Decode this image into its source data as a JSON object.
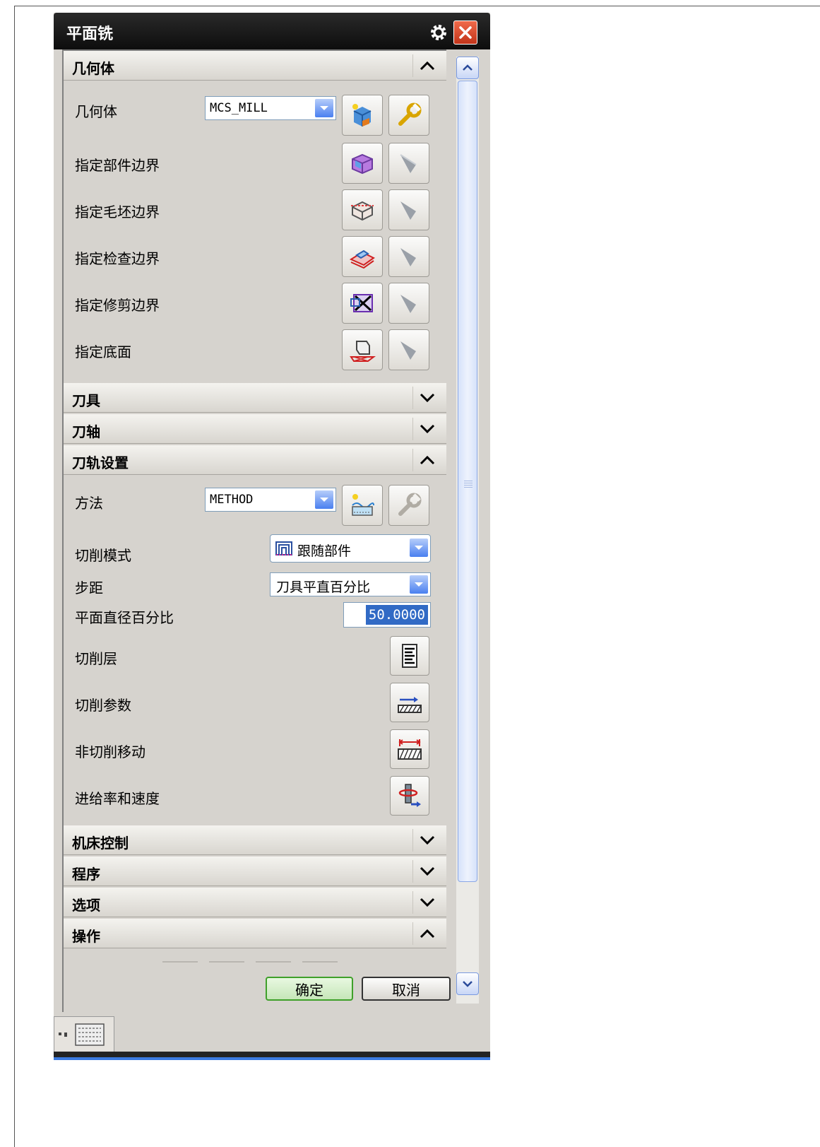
{
  "window": {
    "title": "平面铣"
  },
  "sections": {
    "geometry": {
      "title": "几何体",
      "expanded": true,
      "geometry_label": "几何体",
      "geometry_value": "MCS_MILL",
      "rows": [
        {
          "label": "指定部件边界"
        },
        {
          "label": "指定毛坯边界"
        },
        {
          "label": "指定检查边界"
        },
        {
          "label": "指定修剪边界"
        },
        {
          "label": "指定底面"
        }
      ]
    },
    "tool": {
      "title": "刀具",
      "expanded": false
    },
    "axis": {
      "title": "刀轴",
      "expanded": false
    },
    "path_settings": {
      "title": "刀轨设置",
      "expanded": true,
      "method_label": "方法",
      "method_value": "METHOD",
      "cut_pattern_label": "切削模式",
      "cut_pattern_value": "跟随部件",
      "stepover_label": "步距",
      "stepover_value": "刀具平直百分比",
      "flat_diameter_label": "平面直径百分比",
      "flat_diameter_value": "50.0000",
      "cut_levels_label": "切削层",
      "cut_params_label": "切削参数",
      "non_cutting_label": "非切削移动",
      "feeds_speeds_label": "进给率和速度"
    },
    "machine_control": {
      "title": "机床控制",
      "expanded": false
    },
    "program": {
      "title": "程序",
      "expanded": false
    },
    "options": {
      "title": "选项",
      "expanded": false
    },
    "actions": {
      "title": "操作",
      "expanded": true
    }
  },
  "footer": {
    "ok_label": "确定",
    "cancel_label": "取消"
  },
  "icons": {
    "gear": "gear-icon",
    "close": "close-icon",
    "expand": "chevron-down-icon",
    "collapse": "chevron-up-icon"
  },
  "colors": {
    "titlebar": "#111111",
    "close": "#d9482a",
    "selection": "#316ac5",
    "ok_border": "#3fa02a"
  }
}
